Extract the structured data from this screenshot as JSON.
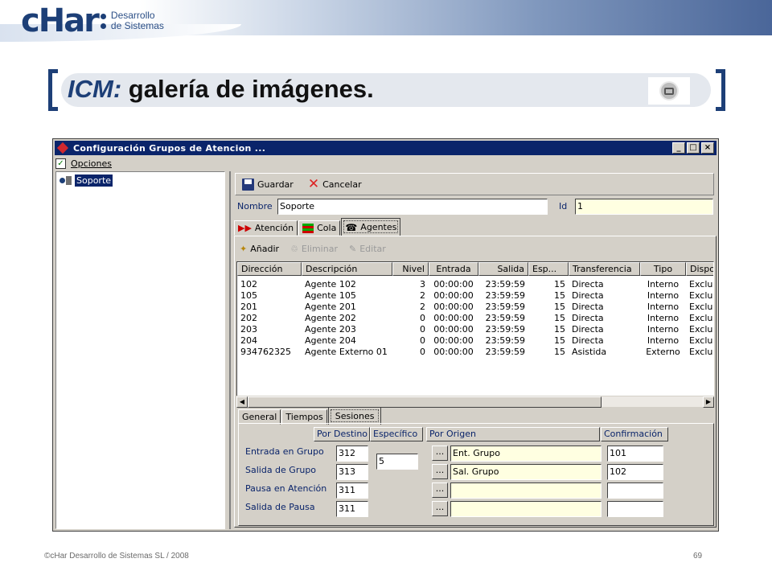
{
  "slide": {
    "logo_text": "cHar",
    "logo_sub1": "Desarrollo",
    "logo_sub2": "de Sistemas",
    "title_em": "ICM:",
    "title_rest": " galería de imágenes.",
    "footer": "©cHar Desarrollo de Sistemas SL / 2008",
    "page_number": "69"
  },
  "window": {
    "title": "Configuración Grupos de Atencion ...",
    "controls": [
      "_",
      "□",
      "×"
    ],
    "menu": [
      "Opciones"
    ],
    "tree": [
      "Soporte"
    ]
  },
  "toolbar": {
    "save_label": "Guardar",
    "cancel_label": "Cancelar"
  },
  "form": {
    "nombre_label": "Nombre",
    "nombre_value": "Soporte",
    "id_label": "Id",
    "id_value": "1"
  },
  "tabs": [
    "Atención",
    "Cola",
    "Agentes"
  ],
  "active_tab": "Agentes",
  "agent_toolbar": {
    "add_label": "Añadir",
    "delete_label": "Eliminar",
    "edit_label": "Editar"
  },
  "agents_table": {
    "columns": [
      "Dirección",
      "Descripción",
      "Nivel",
      "Entrada",
      "Salida",
      "Esp...",
      "Transferencia",
      "Tipo",
      "Dispo"
    ],
    "rows": [
      [
        "102",
        "Agente 102",
        "3",
        "00:00:00",
        "23:59:59",
        "15",
        "Directa",
        "Interno",
        "Exclu"
      ],
      [
        "105",
        "Agente 105",
        "2",
        "00:00:00",
        "23:59:59",
        "15",
        "Directa",
        "Interno",
        "Exclu"
      ],
      [
        "201",
        "Agente 201",
        "2",
        "00:00:00",
        "23:59:59",
        "15",
        "Directa",
        "Interno",
        "Exclu"
      ],
      [
        "202",
        "Agente 202",
        "0",
        "00:00:00",
        "23:59:59",
        "15",
        "Directa",
        "Interno",
        "Exclu"
      ],
      [
        "203",
        "Agente 203",
        "0",
        "00:00:00",
        "23:59:59",
        "15",
        "Directa",
        "Interno",
        "Exclu"
      ],
      [
        "204",
        "Agente 204",
        "0",
        "00:00:00",
        "23:59:59",
        "15",
        "Directa",
        "Interno",
        "Exclu"
      ],
      [
        "934762325",
        "Agente Externo 01",
        "0",
        "00:00:00",
        "23:59:59",
        "15",
        "Asistida",
        "Externo",
        "Exclu"
      ]
    ]
  },
  "lower_tabs": [
    "General",
    "Tiempos",
    "Sesiones"
  ],
  "lower_active_tab": "Sesiones",
  "sessions": {
    "headers": [
      "Por Destino",
      "Específico",
      "Por Origen",
      "Confirmación"
    ],
    "rows": [
      {
        "label": "Entrada en Grupo",
        "destino": "312",
        "origen": "Ent. Grupo",
        "confirm": "101"
      },
      {
        "label": "Salida de Grupo",
        "destino": "313",
        "origen": "Sal. Grupo",
        "confirm": "102"
      },
      {
        "label": "Pausa en Atención",
        "destino": "311",
        "origen": "",
        "confirm": ""
      },
      {
        "label": "Salida de Pausa",
        "destino": "311",
        "origen": "",
        "confirm": ""
      }
    ],
    "especifico_value": "5",
    "button_label": "..."
  }
}
